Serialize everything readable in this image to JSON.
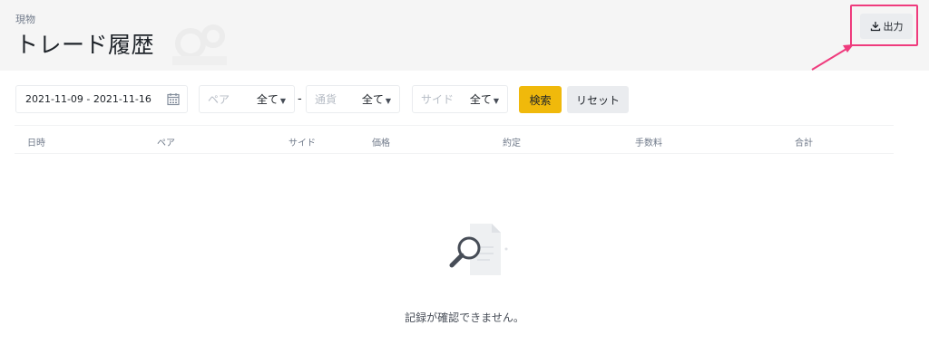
{
  "header": {
    "breadcrumb": "現物",
    "title": "トレード履歴",
    "export_label": "出力"
  },
  "filters": {
    "date_range": "2021-11-09 - 2021-11-16",
    "pair_label": "ペア",
    "pair_value": "全て",
    "separator": "-",
    "currency_label": "通貨",
    "currency_value": "全て",
    "side_label": "サイド",
    "side_value": "全て",
    "search_label": "検索",
    "reset_label": "リセット"
  },
  "table": {
    "columns": [
      "日時",
      "ペア",
      "サイド",
      "価格",
      "約定",
      "手数料",
      "合計"
    ]
  },
  "empty": {
    "message": "記録が確認できません。"
  },
  "colors": {
    "accent": "#f0b90b",
    "highlight": "#ef3b7d"
  }
}
